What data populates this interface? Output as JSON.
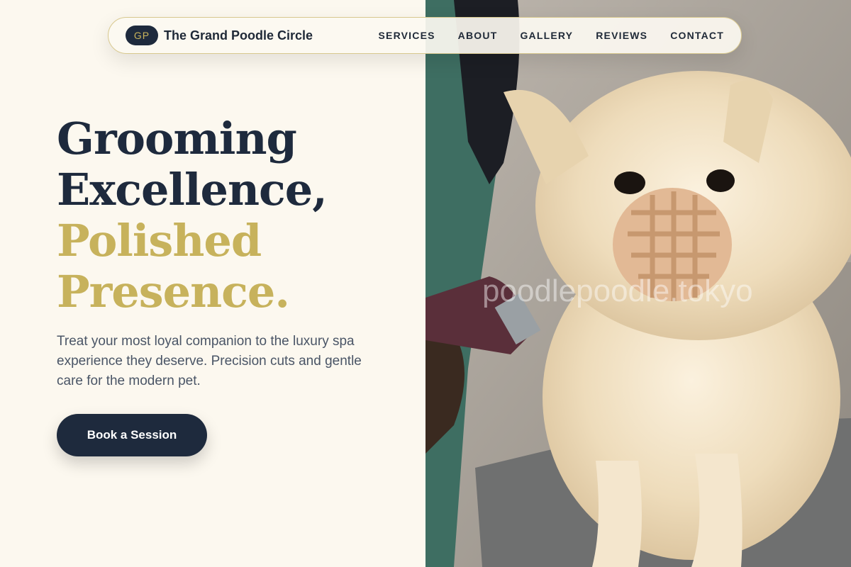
{
  "brand": {
    "badge": "GP",
    "name": "The Grand Poodle Circle"
  },
  "nav": {
    "links": [
      "SERVICES",
      "ABOUT",
      "GALLERY",
      "REVIEWS",
      "CONTACT"
    ]
  },
  "hero": {
    "headline_dark_1": "Grooming",
    "headline_dark_2": "Excellence,",
    "headline_gold_1": "Polished",
    "headline_gold_2": "Presence.",
    "subtext": "Treat your most loyal companion to the luxury spa experience they deserve. Precision cuts and gentle care for the modern pet.",
    "cta_label": "Book a Session"
  },
  "photo": {
    "watermark": "poodlepoodle.tokyo"
  },
  "colors": {
    "navy": "#1e2a3d",
    "gold": "#c7b25c",
    "cream": "#fcf8ef"
  }
}
